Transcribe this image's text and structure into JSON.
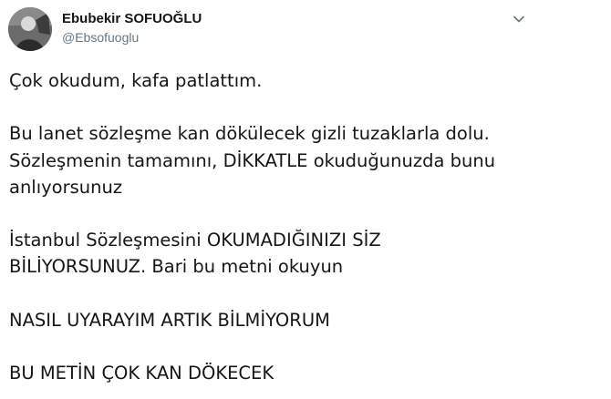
{
  "author": {
    "display_name": "Ebubekir SOFUOĞLU",
    "handle": "@Ebsofuoglu",
    "avatar_icon": "profile-photo"
  },
  "menu": {
    "icon": "chevron-down-icon"
  },
  "tweet": {
    "paragraphs": [
      {
        "lines": [
          "Çok okudum, kafa patlattım."
        ]
      },
      {
        "lines": [
          "Bu lanet sözleşme kan dökülecek gizli tuzaklarla dolu.",
          "Sözleşmenin tamamını, DİKKATLE okuduğunuzda bunu",
          "anlıyorsunuz"
        ]
      },
      {
        "lines": [
          "İstanbul Sözleşmesini OKUMADIĞINIZI SİZ",
          "BİLİYORSUNUZ. Bari bu metni okuyun"
        ]
      },
      {
        "lines": [
          "NASIL UYARAYIM ARTIK BİLMİYORUM"
        ]
      },
      {
        "lines": [
          "BU METİN ÇOK KAN DÖKECEK"
        ]
      }
    ]
  },
  "colors": {
    "text": "#14171a",
    "secondary_text": "#657786",
    "background": "#ffffff"
  }
}
